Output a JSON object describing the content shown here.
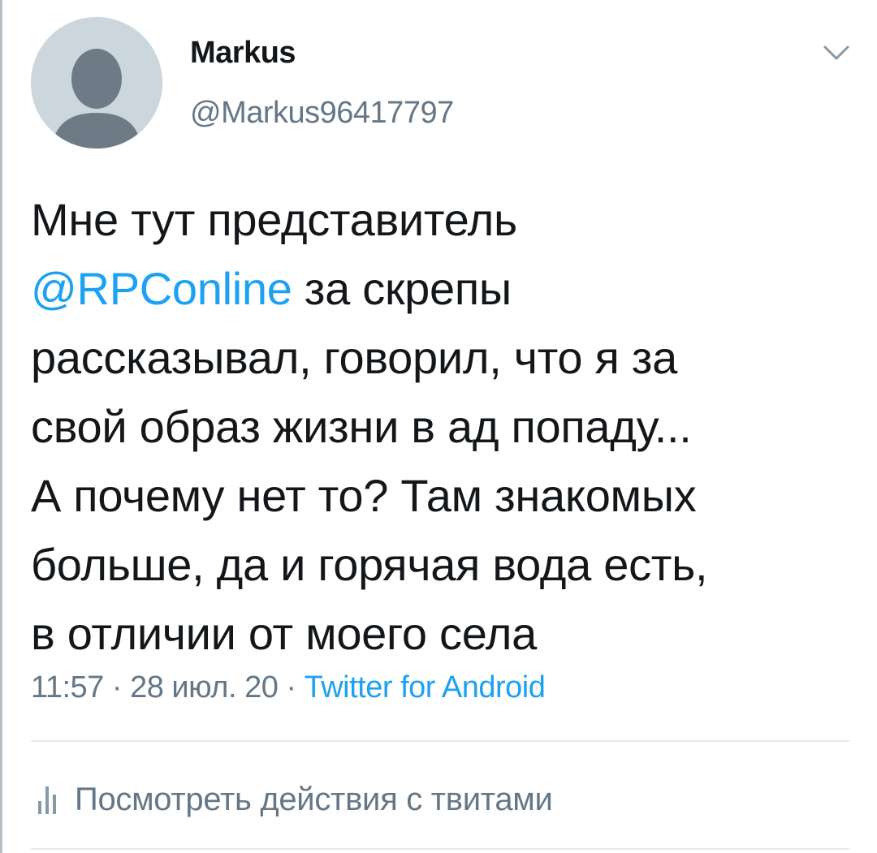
{
  "author": {
    "display_name": "Markus",
    "handle": "@Markus96417797",
    "avatar_icon": "default-profile-silhouette-icon"
  },
  "menu": {
    "icon": "chevron-down-icon"
  },
  "tweet": {
    "line1": "Мне тут представитель",
    "mention": "@RPConline",
    "line2_rest": " за скрепы",
    "line3": "рассказывал, говорил, что я за",
    "line4": "свой образ жизни в ад попаду...",
    "line5": "А почему нет то? Там знакомых",
    "line6": "больше, да и горячая вода есть,",
    "line7": "в отличии от моего села"
  },
  "meta": {
    "time": "11:57",
    "sep1": " · ",
    "date": "28 июл. 20",
    "sep2": " · ",
    "source": "Twitter for Android"
  },
  "activity": {
    "icon": "bar-chart-icon",
    "label": "Посмотреть действия с твитами"
  },
  "colors": {
    "accent": "#1da1f2",
    "text_primary": "#14171a",
    "text_secondary": "#657786",
    "avatar_bg": "#ccd6dd",
    "avatar_figure": "#6e7b87",
    "divider": "#e6ecf0"
  }
}
